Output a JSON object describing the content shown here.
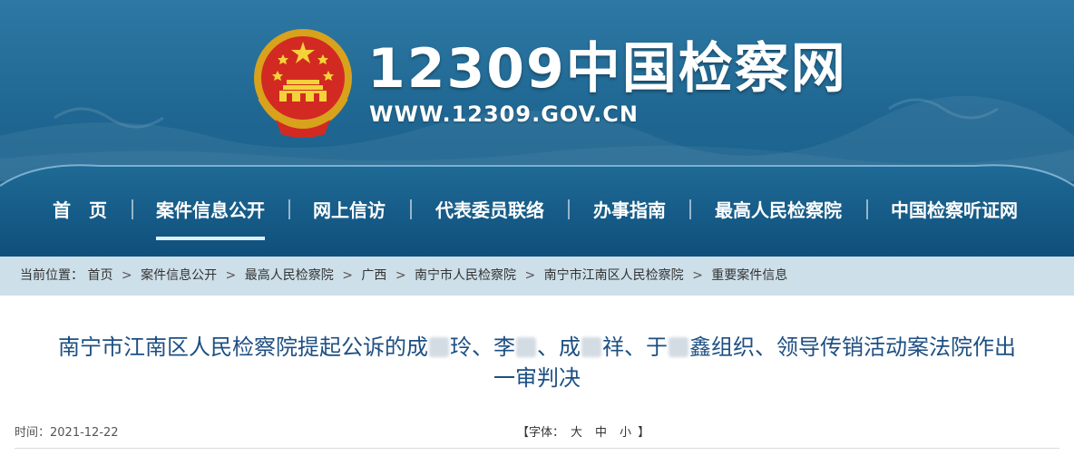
{
  "header": {
    "site_title": "12309中国检察网",
    "site_url": "WWW.12309.GOV.CN"
  },
  "colors": {
    "banner": "#1f6792",
    "nav_text": "#ffffff",
    "breadcrumb_bg": "#cddfe9",
    "title_text": "#1d4f83"
  },
  "nav": {
    "items": [
      {
        "label": "首　页"
      },
      {
        "label": "案件信息公开"
      },
      {
        "label": "网上信访"
      },
      {
        "label": "代表委员联络"
      },
      {
        "label": "办事指南"
      },
      {
        "label": "最高人民检察院"
      },
      {
        "label": "中国检察听证网"
      }
    ],
    "active": "案件信息公开"
  },
  "breadcrumb": {
    "prefix": "当前位置：",
    "items": [
      {
        "label": "首页"
      },
      {
        "label": "案件信息公开"
      },
      {
        "label": "最高人民检察院"
      },
      {
        "label": "广西"
      },
      {
        "label": "南宁市人民检察院"
      },
      {
        "label": "南宁市江南区人民检察院"
      },
      {
        "label": "重要案件信息"
      }
    ],
    "separator": ">"
  },
  "article": {
    "title_parts": [
      "南宁市江南区人民检察院提起公诉的成",
      "玲、李",
      "、成",
      "祥、于",
      "鑫组织、领导传销活动案法院作出",
      "一审判决"
    ],
    "time": "时间：2021-12-22",
    "font_size_label": "【字体：",
    "font_large": "大",
    "font_medium": "中",
    "font_small": "小",
    "font_size_close": "】"
  }
}
